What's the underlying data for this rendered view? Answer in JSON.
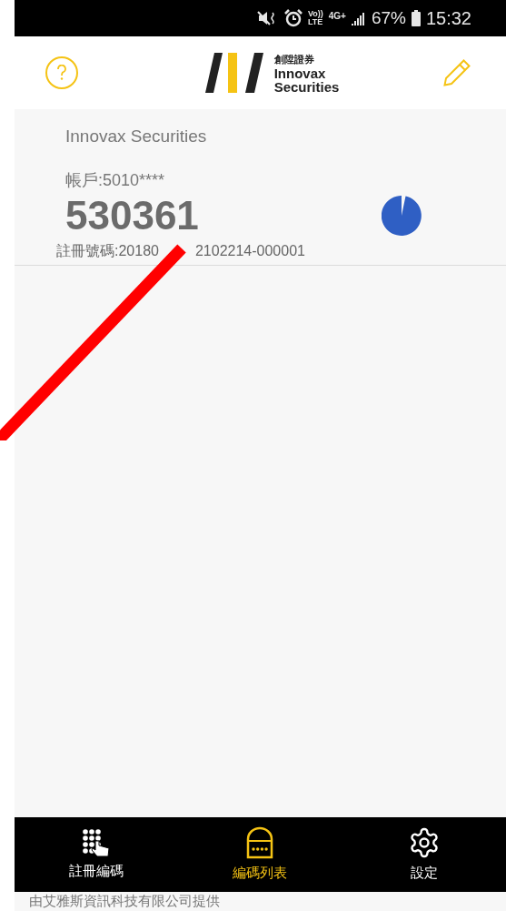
{
  "status_bar": {
    "volte_top": "Vo))",
    "volte_bottom": "LTE",
    "network": "4G+",
    "battery": "67%",
    "time": "15:32"
  },
  "header": {
    "logo_chinese": "創陞證券",
    "logo_line1": "Innovax",
    "logo_line2": "Securities"
  },
  "account": {
    "company": "Innovax Securities",
    "account": "帳戶:5010****",
    "code": "530361",
    "registration_parts": [
      "註冊號碼:20180",
      "2102214-000001"
    ]
  },
  "nav": [
    {
      "kind": "keypad",
      "label": "註冊編碼",
      "selected": false
    },
    {
      "kind": "lock",
      "label": "編碼列表",
      "selected": true
    },
    {
      "kind": "gear",
      "label": "設定",
      "selected": false
    }
  ],
  "footer": "由艾雅斯資訊科技有限公司提供"
}
